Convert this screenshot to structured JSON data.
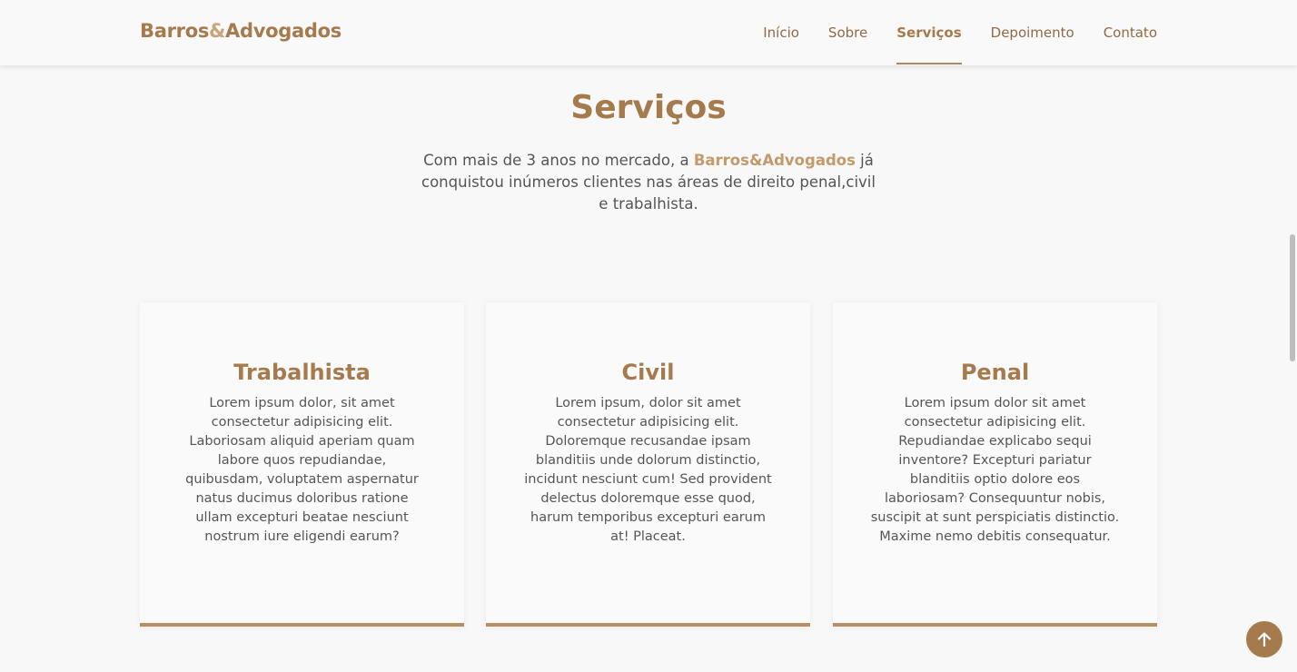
{
  "header": {
    "logo": {
      "part1": "Barros",
      "amp": "&",
      "part2": "Advogados"
    },
    "nav": [
      {
        "label": "Início",
        "active": false
      },
      {
        "label": "Sobre",
        "active": false
      },
      {
        "label": "Serviços",
        "active": true
      },
      {
        "label": "Depoimento",
        "active": false
      },
      {
        "label": "Contato",
        "active": false
      }
    ]
  },
  "services": {
    "title": "Serviços",
    "intro": {
      "before": "Com mais de 3 anos no mercado, a ",
      "brand": "Barros&Advogados",
      "after": " já conquistou inúmeros clientes nas áreas de direito penal,civil e trabalhista."
    },
    "cards": [
      {
        "title": "Trabalhista",
        "text": "Lorem ipsum dolor, sit amet consectetur adipisicing elit. Laboriosam aliquid aperiam quam labore quos repudiandae, quibusdam, voluptatem aspernatur natus ducimus doloribus ratione ullam excepturi beatae nesciunt nostrum iure eligendi earum?"
      },
      {
        "title": "Civil",
        "text": "Lorem ipsum, dolor sit amet consectetur adipisicing elit. Doloremque recusandae ipsam blanditiis unde dolorum distinctio, incidunt nesciunt cum! Sed provident delectus doloremque esse quod, harum temporibus excepturi earum at! Placeat."
      },
      {
        "title": "Penal",
        "text": "Lorem ipsum dolor sit amet consectetur adipisicing elit. Repudiandae explicabo sequi inventore? Excepturi pariatur blanditiis optio dolore eos laboriosam? Consequuntur nobis, suscipit at sunt perspiciatis distinctio. Maxime nemo debitis consequatur."
      }
    ]
  },
  "back_to_top": {
    "icon": "arrow-up-icon"
  },
  "colors": {
    "accent": "#a57a4d",
    "accent_light": "#c29a6c",
    "border": "#b78f62",
    "background": "#f9f8f8"
  }
}
